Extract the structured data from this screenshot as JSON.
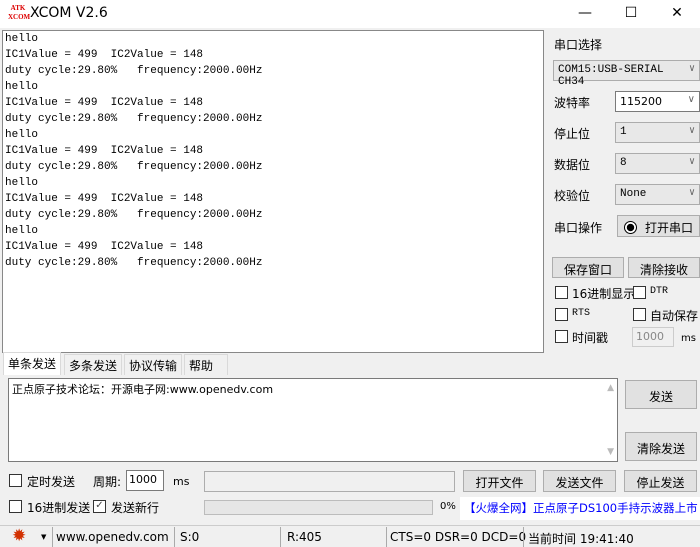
{
  "window": {
    "title": "XCOM V2.6",
    "logo_text": "ATK XCOM",
    "minimize": "—",
    "maximize": "☐",
    "close": "✕"
  },
  "receive_lines": [
    "hello",
    "IC1Value = 499  IC2Value = 148",
    "duty cycle:29.80%   frequency:2000.00Hz",
    "hello",
    "IC1Value = 499  IC2Value = 148",
    "duty cycle:29.80%   frequency:2000.00Hz",
    "hello",
    "IC1Value = 499  IC2Value = 148",
    "duty cycle:29.80%   frequency:2000.00Hz",
    "hello",
    "IC1Value = 499  IC2Value = 148",
    "duty cycle:29.80%   frequency:2000.00Hz",
    "hello",
    "IC1Value = 499  IC2Value = 148",
    "duty cycle:29.80%   frequency:2000.00Hz"
  ],
  "panel": {
    "port_select_label": "串口选择",
    "port": "COM15:USB-SERIAL CH34",
    "baud_label": "波特率",
    "baud": "115200",
    "stop_label": "停止位",
    "stop": "1",
    "data_label": "数据位",
    "data": "8",
    "parity_label": "校验位",
    "parity": "None",
    "op_label": "串口操作",
    "open_port": "打开串口",
    "save_window": "保存窗口",
    "clear_recv": "清除接收",
    "hex_display": "16进制显示",
    "dtr": "DTR",
    "rts": "RTS",
    "auto_save": "自动保存",
    "timestamp": "时间戳",
    "timestamp_ms": "1000",
    "ms": "ms"
  },
  "tabs": [
    "单条发送",
    "多条发送",
    "协议传输",
    "帮助"
  ],
  "send": {
    "text": "正点原子技术论坛：开源电子网:www.openedv.com",
    "send_btn": "发送",
    "clear_send": "清除发送"
  },
  "bottom": {
    "timed_send": "定时发送",
    "period_label": "周期:",
    "period": "1000",
    "ms": "ms",
    "open_file": "打开文件",
    "send_file": "发送文件",
    "stop_send": "停止发送",
    "hex_send": "16进制发送",
    "send_newline": "发送新行",
    "progress_text": "0%",
    "progress": 0,
    "ad": "【火爆全网】正点原子DS100手持示波器上市"
  },
  "status": {
    "url": "www.openedv.com",
    "sent": "S:0",
    "recv": "R:405",
    "lines": "CTS=0 DSR=0 DCD=0",
    "time": "当前时间 19:41:40"
  }
}
